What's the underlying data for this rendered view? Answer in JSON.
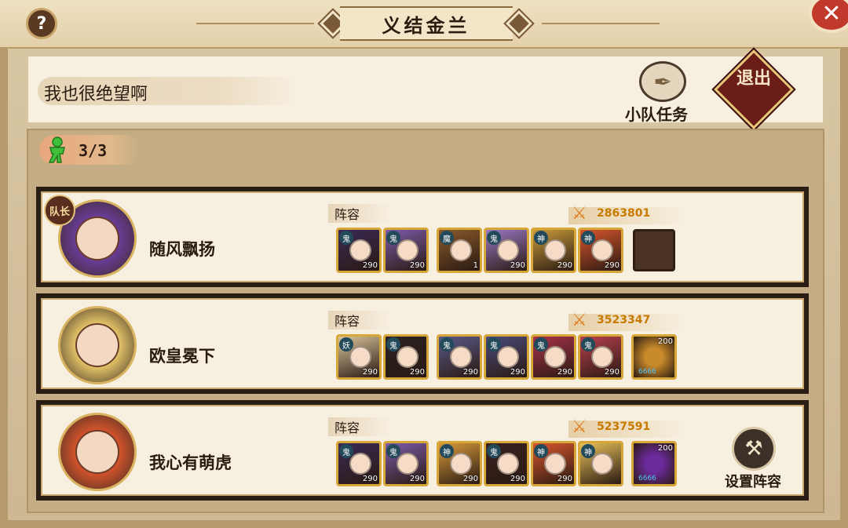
{
  "window": {
    "title": "义结金兰",
    "help_glyph": "?",
    "close_glyph": "✕"
  },
  "team": {
    "name": "我也很绝望啊",
    "task_label": "小队任务",
    "exit_label": "退出",
    "member_count": "3/3"
  },
  "members": [
    {
      "name": "随风飘扬",
      "is_leader": true,
      "leader_badge": "队长",
      "lineup_label": "阵容",
      "power": "2863801",
      "heroes": [
        {
          "type": "鬼",
          "level": "290",
          "color": "#3a2a55"
        },
        {
          "type": "鬼",
          "level": "290",
          "color": "#7b5aa8"
        },
        {
          "type": "魔",
          "level": "1",
          "color": "#8a5a2a"
        },
        {
          "type": "鬼",
          "level": "290",
          "color": "#9a78c4"
        },
        {
          "type": "神",
          "level": "290",
          "color": "#c89a3a"
        },
        {
          "type": "神",
          "level": "290",
          "color": "#d8552c"
        }
      ],
      "pet": null
    },
    {
      "name": "欧皇冕下",
      "is_leader": false,
      "lineup_label": "阵容",
      "power": "3523347",
      "heroes": [
        {
          "type": "妖",
          "level": "290",
          "color": "#d9c49a"
        },
        {
          "type": "鬼",
          "level": "290",
          "color": "#2a2222"
        },
        {
          "type": "鬼",
          "level": "290",
          "color": "#5a5a8a"
        },
        {
          "type": "鬼",
          "level": "290",
          "color": "#4a4a7a"
        },
        {
          "type": "鬼",
          "level": "290",
          "color": "#a8324a"
        },
        {
          "type": "鬼",
          "level": "290",
          "color": "#b8404e"
        }
      ],
      "pet": {
        "level": "200",
        "stars": "6666",
        "color": "#c88a2a"
      }
    },
    {
      "name": "我心有萌虎",
      "is_leader": false,
      "lineup_label": "阵容",
      "power": "5237591",
      "heroes": [
        {
          "type": "鬼",
          "level": "290",
          "color": "#3a2a55"
        },
        {
          "type": "鬼",
          "level": "290",
          "color": "#7b5aa8"
        },
        {
          "type": "神",
          "level": "290",
          "color": "#d89a3a"
        },
        {
          "type": "鬼",
          "level": "290",
          "color": "#3a2020"
        },
        {
          "type": "神",
          "level": "290",
          "color": "#d8552c"
        },
        {
          "type": "神",
          "level": "",
          "color": "#e8c05a"
        }
      ],
      "pet": {
        "level": "200",
        "stars": "6666",
        "color": "#6a2a9a"
      },
      "setup_label": "设置阵容"
    }
  ]
}
